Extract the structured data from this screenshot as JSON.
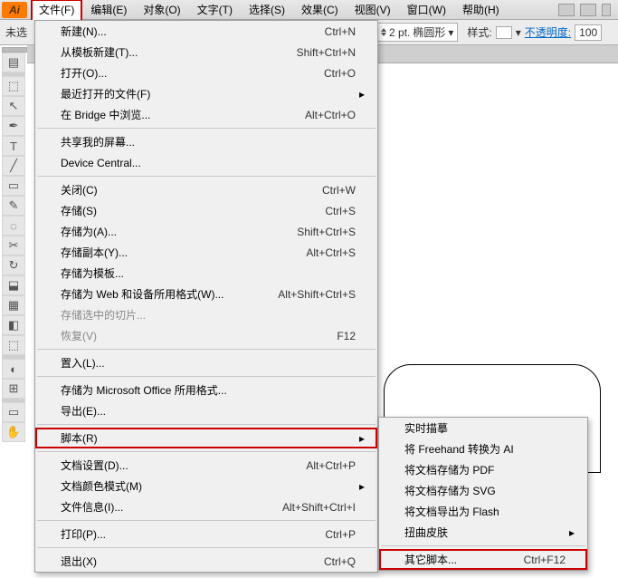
{
  "app_icon": "Ai",
  "menubar": [
    "文件(F)",
    "编辑(E)",
    "对象(O)",
    "文字(T)",
    "选择(S)",
    "效果(C)",
    "视图(V)",
    "窗口(W)",
    "帮助(H)"
  ],
  "menubar_active_index": 0,
  "toolbar2": {
    "left_label": "未选",
    "stroke_value": "2 pt.",
    "stroke_shape": "椭圆形",
    "style_label": "样式:",
    "opacity_label": "不透明度:",
    "opacity_value": "100"
  },
  "file_menu": [
    {
      "label": "新建(N)...",
      "shortcut": "Ctrl+N"
    },
    {
      "label": "从模板新建(T)...",
      "shortcut": "Shift+Ctrl+N"
    },
    {
      "label": "打开(O)...",
      "shortcut": "Ctrl+O"
    },
    {
      "label": "最近打开的文件(F)",
      "shortcut": "",
      "arrow": true
    },
    {
      "label": "在 Bridge 中浏览...",
      "shortcut": "Alt+Ctrl+O"
    },
    {
      "sep": true
    },
    {
      "label": "共享我的屏幕...",
      "shortcut": ""
    },
    {
      "label": "Device Central...",
      "shortcut": ""
    },
    {
      "sep": true
    },
    {
      "label": "关闭(C)",
      "shortcut": "Ctrl+W"
    },
    {
      "label": "存储(S)",
      "shortcut": "Ctrl+S"
    },
    {
      "label": "存储为(A)...",
      "shortcut": "Shift+Ctrl+S"
    },
    {
      "label": "存储副本(Y)...",
      "shortcut": "Alt+Ctrl+S"
    },
    {
      "label": "存储为模板...",
      "shortcut": ""
    },
    {
      "label": "存储为 Web 和设备所用格式(W)...",
      "shortcut": "Alt+Shift+Ctrl+S"
    },
    {
      "label": "存储选中的切片...",
      "shortcut": "",
      "disabled": true
    },
    {
      "label": "恢复(V)",
      "shortcut": "F12",
      "disabled": true
    },
    {
      "sep": true
    },
    {
      "label": "置入(L)...",
      "shortcut": ""
    },
    {
      "sep": true
    },
    {
      "label": "存储为 Microsoft Office 所用格式...",
      "shortcut": ""
    },
    {
      "label": "导出(E)...",
      "shortcut": ""
    },
    {
      "sep": true
    },
    {
      "label": "脚本(R)",
      "shortcut": "",
      "arrow": true,
      "hilite": true
    },
    {
      "sep": true
    },
    {
      "label": "文档设置(D)...",
      "shortcut": "Alt+Ctrl+P"
    },
    {
      "label": "文档颜色模式(M)",
      "shortcut": "",
      "arrow": true
    },
    {
      "label": "文件信息(I)...",
      "shortcut": "Alt+Shift+Ctrl+I"
    },
    {
      "sep": true
    },
    {
      "label": "打印(P)...",
      "shortcut": "Ctrl+P"
    },
    {
      "sep": true
    },
    {
      "label": "退出(X)",
      "shortcut": "Ctrl+Q"
    }
  ],
  "submenu": [
    {
      "label": "实时描摹",
      "shortcut": ""
    },
    {
      "label": "将 Freehand 转换为 AI",
      "shortcut": ""
    },
    {
      "label": "将文档存储为 PDF",
      "shortcut": ""
    },
    {
      "label": "将文档存储为 SVG",
      "shortcut": ""
    },
    {
      "label": "将文档导出为 Flash",
      "shortcut": ""
    },
    {
      "label": "扭曲皮肤",
      "shortcut": "",
      "arrow": true
    },
    {
      "sep": true
    },
    {
      "label": "其它脚本...",
      "shortcut": "Ctrl+F12",
      "hilite": true
    }
  ],
  "tools": [
    "grip",
    "▤",
    "sep",
    "⬚",
    "↖",
    "✒",
    "T",
    "╱",
    "▭",
    "✎",
    "◌",
    "✂",
    "↻",
    "⬓",
    "▦",
    "◧",
    "⬚",
    "sep",
    "◐",
    "⊞",
    "sep",
    "▭",
    "✋"
  ]
}
